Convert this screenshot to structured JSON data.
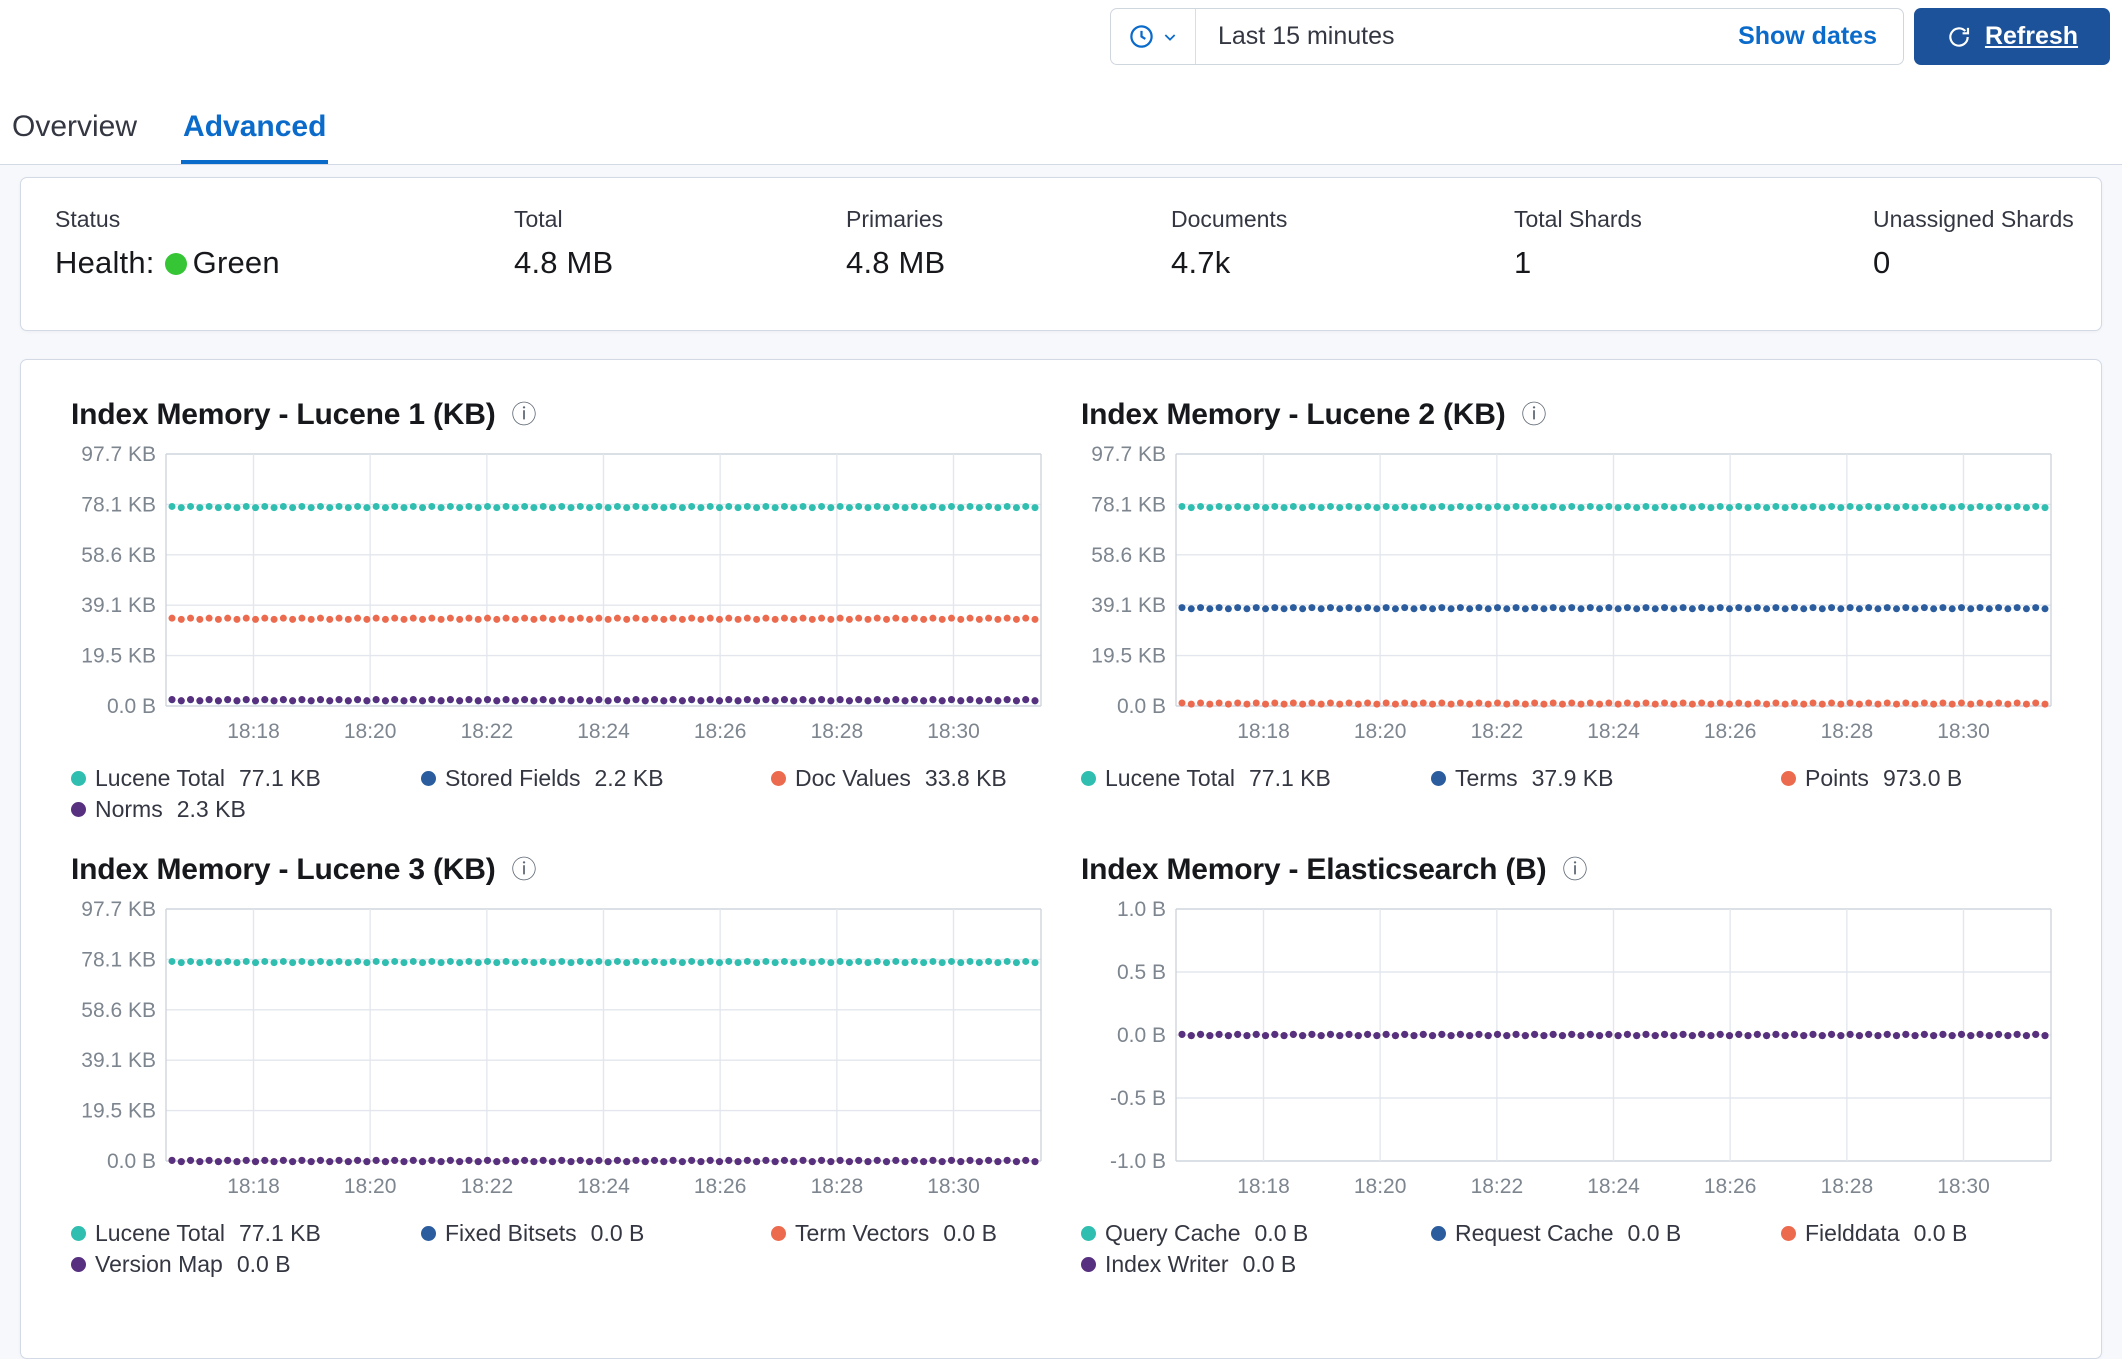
{
  "header": {
    "time_range": "Last 15 minutes",
    "show_dates": "Show dates",
    "refresh": "Refresh"
  },
  "tabs": [
    {
      "label": "Overview",
      "active": false
    },
    {
      "label": "Advanced",
      "active": true
    }
  ],
  "summary": {
    "items": [
      {
        "label": "Status",
        "health_prefix": "Health:",
        "value": "Green"
      },
      {
        "label": "Total",
        "value": "4.8 MB"
      },
      {
        "label": "Primaries",
        "value": "4.8 MB"
      },
      {
        "label": "Documents",
        "value": "4.7k"
      },
      {
        "label": "Total Shards",
        "value": "1"
      },
      {
        "label": "Unassigned Shards",
        "value": "0"
      }
    ]
  },
  "icons": {
    "info": "ⓘ"
  },
  "palette": {
    "teal": "#2fbeb0",
    "blue": "#2b5d9e",
    "orange": "#ec6a4e",
    "purple": "#57307f",
    "green": "#35c535",
    "link": "#0b6bcb",
    "button": "#1b5299",
    "grid": "#e3e7ed",
    "plot_border": "#cfd5dd",
    "tick_text": "#7d858f"
  },
  "chart_data": [
    {
      "type": "line",
      "title": "Index Memory - Lucene 1 (KB)",
      "ylim": [
        0,
        100000
      ],
      "y_ticks": [
        {
          "label": "97.7 KB",
          "value": 100000
        },
        {
          "label": "78.1 KB",
          "value": 80000
        },
        {
          "label": "58.6 KB",
          "value": 60000
        },
        {
          "label": "39.1 KB",
          "value": 40000
        },
        {
          "label": "19.5 KB",
          "value": 20000
        },
        {
          "label": "0.0 B",
          "value": 0
        }
      ],
      "x_ticks": [
        {
          "label": "18:18",
          "f": 0.1
        },
        {
          "label": "18:20",
          "f": 0.2333
        },
        {
          "label": "18:22",
          "f": 0.3667
        },
        {
          "label": "18:24",
          "f": 0.5
        },
        {
          "label": "18:26",
          "f": 0.6333
        },
        {
          "label": "18:28",
          "f": 0.7667
        },
        {
          "label": "18:30",
          "f": 0.9
        }
      ],
      "series": [
        {
          "name": "Lucene Total",
          "value_label": "77.1 KB",
          "y": 78950,
          "color": "teal"
        },
        {
          "name": "Stored Fields",
          "value_label": "2.2 KB",
          "y": 2253,
          "color": "blue"
        },
        {
          "name": "Doc Values",
          "value_label": "33.8 KB",
          "y": 34611,
          "color": "orange"
        },
        {
          "name": "Norms",
          "value_label": "2.3 KB",
          "y": 2355,
          "color": "purple"
        }
      ]
    },
    {
      "type": "line",
      "title": "Index Memory - Lucene 2 (KB)",
      "ylim": [
        0,
        100000
      ],
      "y_ticks": [
        {
          "label": "97.7 KB",
          "value": 100000
        },
        {
          "label": "78.1 KB",
          "value": 80000
        },
        {
          "label": "58.6 KB",
          "value": 60000
        },
        {
          "label": "39.1 KB",
          "value": 40000
        },
        {
          "label": "19.5 KB",
          "value": 20000
        },
        {
          "label": "0.0 B",
          "value": 0
        }
      ],
      "x_ticks": [
        {
          "label": "18:18",
          "f": 0.1
        },
        {
          "label": "18:20",
          "f": 0.2333
        },
        {
          "label": "18:22",
          "f": 0.3667
        },
        {
          "label": "18:24",
          "f": 0.5
        },
        {
          "label": "18:26",
          "f": 0.6333
        },
        {
          "label": "18:28",
          "f": 0.7667
        },
        {
          "label": "18:30",
          "f": 0.9
        }
      ],
      "series": [
        {
          "name": "Lucene Total",
          "value_label": "77.1 KB",
          "y": 78950,
          "color": "teal"
        },
        {
          "name": "Terms",
          "value_label": "37.9 KB",
          "y": 38810,
          "color": "blue"
        },
        {
          "name": "Points",
          "value_label": "973.0 B",
          "y": 973,
          "color": "orange"
        }
      ]
    },
    {
      "type": "line",
      "title": "Index Memory - Lucene 3 (KB)",
      "ylim": [
        0,
        100000
      ],
      "y_ticks": [
        {
          "label": "97.7 KB",
          "value": 100000
        },
        {
          "label": "78.1 KB",
          "value": 80000
        },
        {
          "label": "58.6 KB",
          "value": 60000
        },
        {
          "label": "39.1 KB",
          "value": 40000
        },
        {
          "label": "19.5 KB",
          "value": 20000
        },
        {
          "label": "0.0 B",
          "value": 0
        }
      ],
      "x_ticks": [
        {
          "label": "18:18",
          "f": 0.1
        },
        {
          "label": "18:20",
          "f": 0.2333
        },
        {
          "label": "18:22",
          "f": 0.3667
        },
        {
          "label": "18:24",
          "f": 0.5
        },
        {
          "label": "18:26",
          "f": 0.6333
        },
        {
          "label": "18:28",
          "f": 0.7667
        },
        {
          "label": "18:30",
          "f": 0.9
        }
      ],
      "series": [
        {
          "name": "Lucene Total",
          "value_label": "77.1 KB",
          "y": 78950,
          "color": "teal"
        },
        {
          "name": "Fixed Bitsets",
          "value_label": "0.0 B",
          "y": 0,
          "color": "blue"
        },
        {
          "name": "Term Vectors",
          "value_label": "0.0 B",
          "y": 0,
          "color": "orange"
        },
        {
          "name": "Version Map",
          "value_label": "0.0 B",
          "y": 0,
          "color": "purple"
        }
      ]
    },
    {
      "type": "line",
      "title": "Index Memory - Elasticsearch (B)",
      "ylim": [
        -1,
        1
      ],
      "y_ticks": [
        {
          "label": "1.0 B",
          "value": 1
        },
        {
          "label": "0.5 B",
          "value": 0.5
        },
        {
          "label": "0.0 B",
          "value": 0
        },
        {
          "label": "-0.5 B",
          "value": -0.5
        },
        {
          "label": "-1.0 B",
          "value": -1
        }
      ],
      "x_ticks": [
        {
          "label": "18:18",
          "f": 0.1
        },
        {
          "label": "18:20",
          "f": 0.2333
        },
        {
          "label": "18:22",
          "f": 0.3667
        },
        {
          "label": "18:24",
          "f": 0.5
        },
        {
          "label": "18:26",
          "f": 0.6333
        },
        {
          "label": "18:28",
          "f": 0.7667
        },
        {
          "label": "18:30",
          "f": 0.9
        }
      ],
      "series": [
        {
          "name": "Query Cache",
          "value_label": "0.0 B",
          "y": 0,
          "color": "teal"
        },
        {
          "name": "Request Cache",
          "value_label": "0.0 B",
          "y": 0,
          "color": "blue"
        },
        {
          "name": "Fielddata",
          "value_label": "0.0 B",
          "y": 0,
          "color": "orange"
        },
        {
          "name": "Index Writer",
          "value_label": "0.0 B",
          "y": 0,
          "color": "purple"
        }
      ]
    }
  ]
}
